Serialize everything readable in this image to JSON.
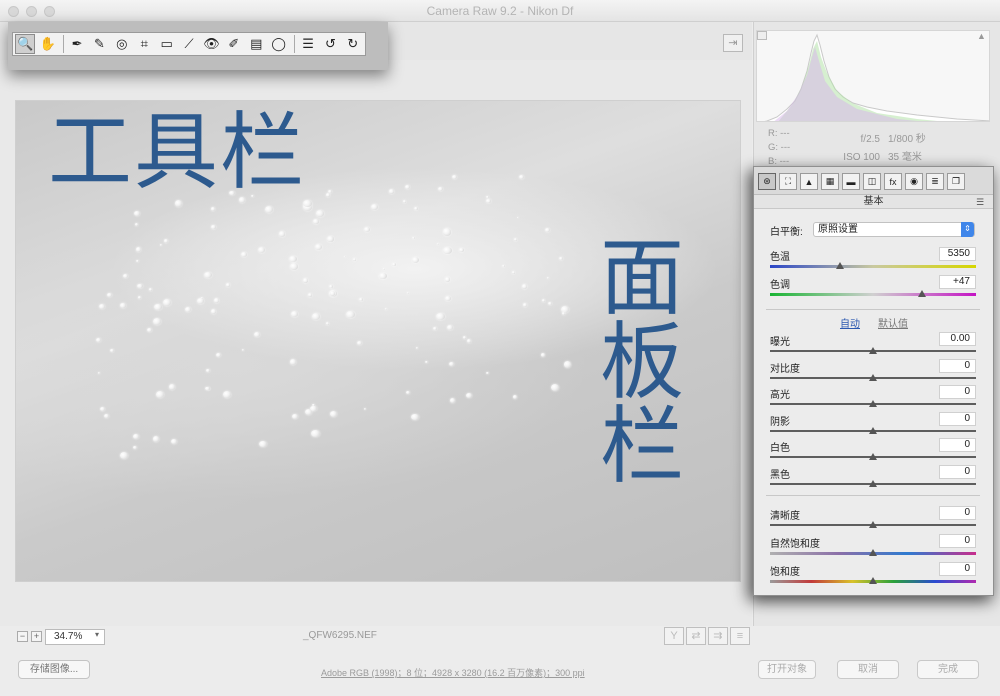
{
  "window": {
    "title": "Camera Raw 9.2 -  Nikon Df"
  },
  "toolbar": {
    "tools": [
      {
        "icon": "zoom-tool-icon",
        "glyph": "🔍"
      },
      {
        "icon": "hand-tool-icon",
        "glyph": "✋"
      },
      {
        "icon": "white-balance-tool-icon",
        "glyph": "✒"
      },
      {
        "icon": "color-sampler-tool-icon",
        "glyph": "✎"
      },
      {
        "icon": "targeted-adjustment-tool-icon",
        "glyph": "◎"
      },
      {
        "icon": "crop-tool-icon",
        "glyph": "⌗"
      },
      {
        "icon": "straighten-tool-icon",
        "glyph": "▭"
      },
      {
        "icon": "spot-removal-tool-icon",
        "glyph": "⟋"
      },
      {
        "icon": "red-eye-removal-icon",
        "glyph": "👁"
      },
      {
        "icon": "adjustment-brush-icon",
        "glyph": "✐"
      },
      {
        "icon": "graduated-filter-icon",
        "glyph": "▤"
      },
      {
        "icon": "radial-filter-icon",
        "glyph": "◯"
      },
      {
        "icon": "preferences-icon",
        "glyph": "☰"
      },
      {
        "icon": "rotate-left-icon",
        "glyph": "↺"
      },
      {
        "icon": "rotate-right-icon",
        "glyph": "↻"
      }
    ]
  },
  "preview": {
    "label_toolbar": "工具栏",
    "label_panel": "面板栏",
    "zoom": "34.7%",
    "filename": "_QFW6295.NEF"
  },
  "info": {
    "r": "R:   ---",
    "g": "G:   ---",
    "b": "B:   ---",
    "aperture": "f/2.5",
    "shutter": "1/800 秒",
    "iso": "ISO 100",
    "focal": "35 毫米"
  },
  "panel": {
    "title": "基本",
    "tabs": [
      {
        "icon": "basic-tab-icon",
        "glyph": "⊛"
      },
      {
        "icon": "tone-curve-tab-icon",
        "glyph": "⛶"
      },
      {
        "icon": "detail-tab-icon",
        "glyph": "▲"
      },
      {
        "icon": "hsl-tab-icon",
        "glyph": "▦"
      },
      {
        "icon": "split-toning-tab-icon",
        "glyph": "▬"
      },
      {
        "icon": "lens-corrections-tab-icon",
        "glyph": "◫"
      },
      {
        "icon": "effects-tab-icon",
        "glyph": "fx"
      },
      {
        "icon": "camera-calibration-tab-icon",
        "glyph": "◉"
      },
      {
        "icon": "presets-tab-icon",
        "glyph": "≣"
      },
      {
        "icon": "snapshots-tab-icon",
        "glyph": "❐"
      }
    ],
    "white_balance_label": "白平衡:",
    "white_balance_value": "原照设置",
    "temp_label": "色温",
    "temp_value": "5350",
    "tint_label": "色调",
    "tint_value": "+47",
    "auto": "自动",
    "default": "默认值",
    "tone": [
      {
        "label": "曝光",
        "value": "0.00"
      },
      {
        "label": "对比度",
        "value": "0"
      },
      {
        "label": "高光",
        "value": "0"
      },
      {
        "label": "阴影",
        "value": "0"
      },
      {
        "label": "白色",
        "value": "0"
      },
      {
        "label": "黑色",
        "value": "0"
      }
    ],
    "presence": [
      {
        "label": "清晰度",
        "value": "0"
      },
      {
        "label": "自然饱和度",
        "value": "0"
      },
      {
        "label": "饱和度",
        "value": "0"
      }
    ],
    "temp_level": 0.34,
    "tint_level": 0.74
  },
  "footer": {
    "save": "存储图像...",
    "workflow": "Adobe RGB (1998)；8 位；4928 x 3280 (16.2 百万像素)；300 ppi",
    "open": "打开对象",
    "cancel": "取消",
    "done": "完成"
  }
}
